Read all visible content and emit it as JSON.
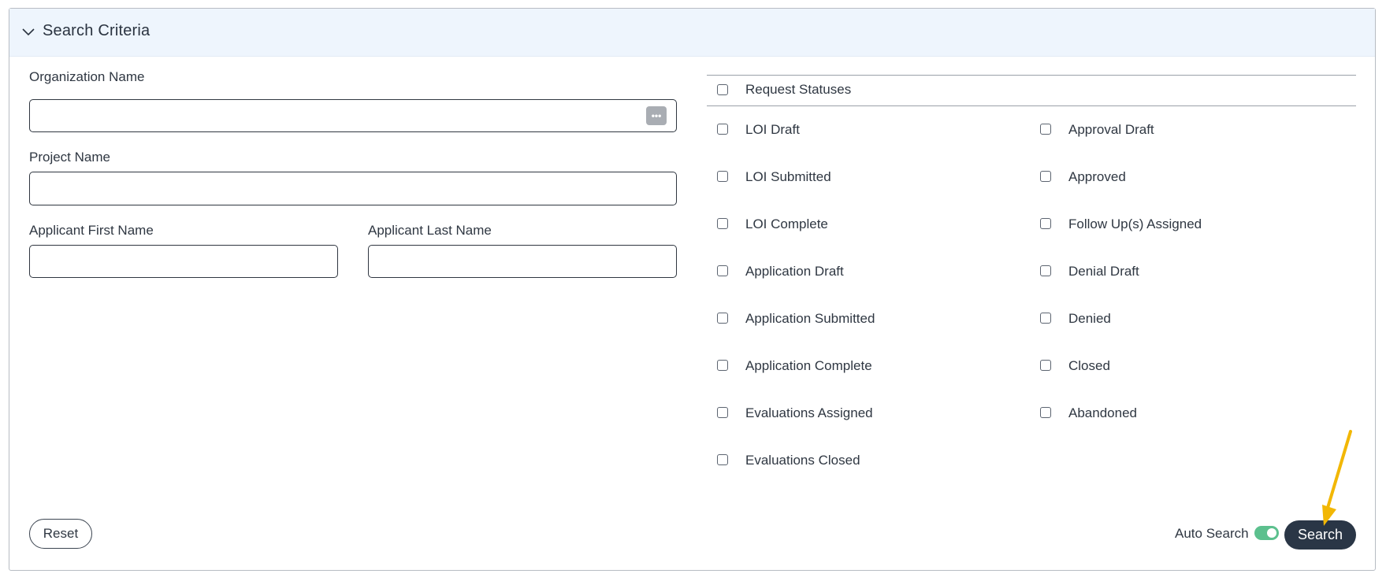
{
  "panel": {
    "title": "Search Criteria"
  },
  "fields": {
    "organization_name": {
      "label": "Organization Name",
      "value": "",
      "lookup_glyph": "•••"
    },
    "project_name": {
      "label": "Project Name",
      "value": ""
    },
    "applicant_first_name": {
      "label": "Applicant First Name",
      "value": ""
    },
    "applicant_last_name": {
      "label": "Applicant Last Name",
      "value": ""
    }
  },
  "statuses": {
    "header": "Request Statuses",
    "left": [
      {
        "label": "LOI Draft",
        "checked": false
      },
      {
        "label": "LOI Submitted",
        "checked": false
      },
      {
        "label": "LOI Complete",
        "checked": false
      },
      {
        "label": "Application Draft",
        "checked": false
      },
      {
        "label": "Application Submitted",
        "checked": false
      },
      {
        "label": "Application Complete",
        "checked": false
      },
      {
        "label": "Evaluations Assigned",
        "checked": false
      },
      {
        "label": "Evaluations Closed",
        "checked": false
      }
    ],
    "right": [
      {
        "label": "Approval Draft",
        "checked": false
      },
      {
        "label": "Approved",
        "checked": false
      },
      {
        "label": "Follow Up(s) Assigned",
        "checked": false
      },
      {
        "label": "Denial Draft",
        "checked": false
      },
      {
        "label": "Denied",
        "checked": false
      },
      {
        "label": "Closed",
        "checked": false
      },
      {
        "label": "Abandoned",
        "checked": false
      }
    ]
  },
  "footer": {
    "reset_label": "Reset",
    "auto_search_label": "Auto Search",
    "auto_search_on": true,
    "search_label": "Search"
  },
  "colors": {
    "header_bg": "#eef5fd",
    "search_button": "#2a3646",
    "toggle_on": "#5cc08e",
    "annotation_arrow": "#f2b705"
  },
  "icons": {
    "collapse": "chevron-down-icon",
    "lookup": "ellipsis-icon",
    "annotation": "arrow-pointer-icon"
  }
}
